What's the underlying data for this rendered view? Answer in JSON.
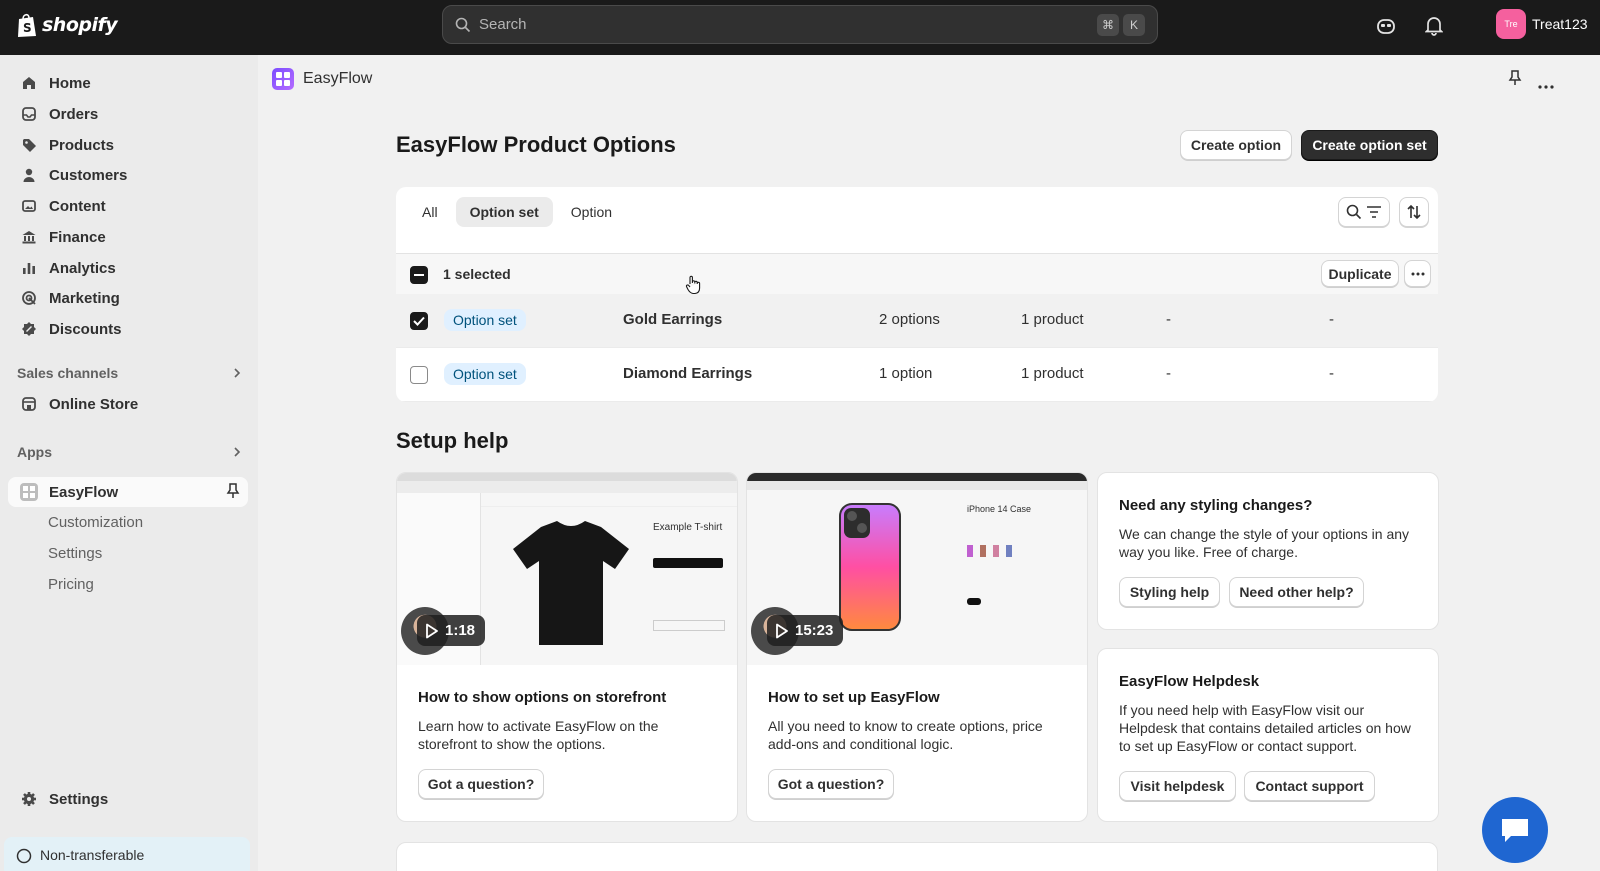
{
  "topbar": {
    "brand": "shopify",
    "search_placeholder": "Search",
    "shortcut_keys": [
      "⌘",
      "K"
    ],
    "avatar_initials": "Tre",
    "user_name": "Treat123"
  },
  "sidebar": {
    "items": [
      {
        "label": "Home",
        "icon": "home-icon"
      },
      {
        "label": "Orders",
        "icon": "inbox-icon"
      },
      {
        "label": "Products",
        "icon": "tag-icon"
      },
      {
        "label": "Customers",
        "icon": "person-icon"
      },
      {
        "label": "Content",
        "icon": "image-icon"
      },
      {
        "label": "Finance",
        "icon": "bank-icon"
      },
      {
        "label": "Analytics",
        "icon": "bar-chart-icon"
      },
      {
        "label": "Marketing",
        "icon": "target-icon"
      },
      {
        "label": "Discounts",
        "icon": "discount-icon"
      }
    ],
    "sales_channels_label": "Sales channels",
    "online_store_label": "Online Store",
    "apps_label": "Apps",
    "app_label": "EasyFlow",
    "app_subitems": [
      "Customization",
      "Settings",
      "Pricing"
    ],
    "settings_label": "Settings",
    "bottom_notice": "Non-transferable"
  },
  "app_header": {
    "title": "EasyFlow"
  },
  "page": {
    "title": "EasyFlow Product Options",
    "create_option_label": "Create option",
    "create_option_set_label": "Create option set"
  },
  "tabs": [
    "All",
    "Option set",
    "Option"
  ],
  "selected_tab": "Option set",
  "table": {
    "selected_text": "1 selected",
    "duplicate_label": "Duplicate",
    "rows": [
      {
        "type": "Option set",
        "name": "Gold Earrings",
        "options": "2 options",
        "products": "1 product",
        "col5": "-",
        "col6": "-",
        "checked": true
      },
      {
        "type": "Option set",
        "name": "Diamond Earrings",
        "options": "1 option",
        "products": "1 product",
        "col5": "-",
        "col6": "-",
        "checked": false
      }
    ]
  },
  "setup_help": {
    "title": "Setup help",
    "videos": [
      {
        "duration": "1:18",
        "title": "How to show options on storefront",
        "desc": "Learn how to activate EasyFlow on the storefront to show the options.",
        "button": "Got a question?",
        "thumb_product": "Example T-shirt"
      },
      {
        "duration": "15:23",
        "title": "How to set up EasyFlow",
        "desc": "All you need to know to create options, price add-ons and conditional logic.",
        "button": "Got a question?",
        "thumb_product": "iPhone 14 Case"
      }
    ],
    "styling": {
      "title": "Need any styling changes?",
      "desc": "We can change the style of your options in any way you like. Free of charge.",
      "btn1": "Styling help",
      "btn2": "Need other help?"
    },
    "helpdesk": {
      "title": "EasyFlow Helpdesk",
      "desc": "If you need help with EasyFlow visit our Helpdesk that contains detailed articles on how to set up EasyFlow or contact support.",
      "btn1": "Visit helpdesk",
      "btn2": "Contact support"
    }
  }
}
